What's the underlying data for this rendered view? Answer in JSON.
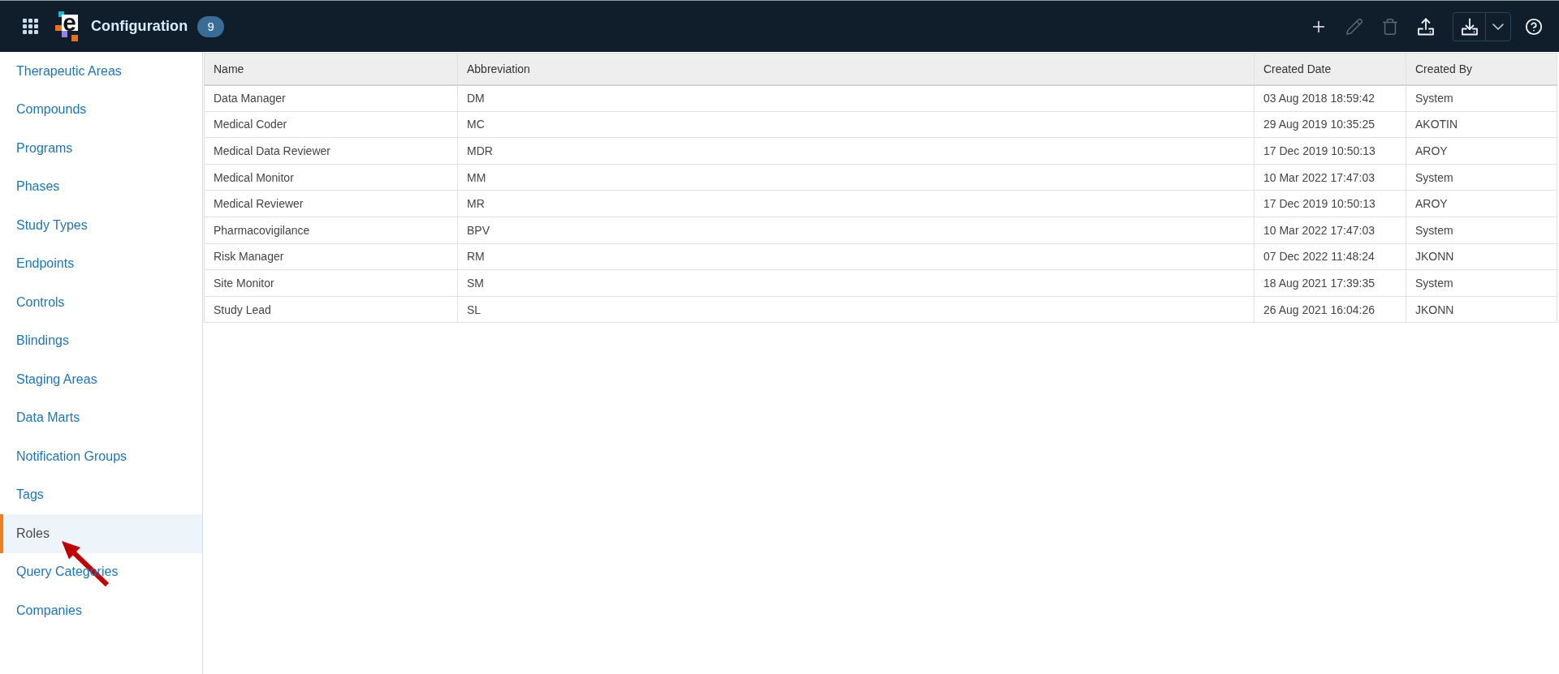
{
  "header": {
    "logo_text": "e",
    "title": "Configuration",
    "count_badge": "9",
    "toolbar": [
      {
        "kind": "add",
        "disabled": false
      },
      {
        "kind": "edit",
        "disabled": true
      },
      {
        "kind": "delete",
        "disabled": true
      },
      {
        "kind": "upload",
        "disabled": false
      },
      {
        "kind": "download",
        "disabled": false
      },
      {
        "kind": "menu",
        "disabled": false
      },
      {
        "kind": "help",
        "disabled": false
      }
    ]
  },
  "sidebar": {
    "items": [
      {
        "label": "Therapeutic Areas",
        "selected": false
      },
      {
        "label": "Compounds",
        "selected": false
      },
      {
        "label": "Programs",
        "selected": false
      },
      {
        "label": "Phases",
        "selected": false
      },
      {
        "label": "Study Types",
        "selected": false
      },
      {
        "label": "Endpoints",
        "selected": false
      },
      {
        "label": "Controls",
        "selected": false
      },
      {
        "label": "Blindings",
        "selected": false
      },
      {
        "label": "Staging Areas",
        "selected": false
      },
      {
        "label": "Data Marts",
        "selected": false
      },
      {
        "label": "Notification Groups",
        "selected": false
      },
      {
        "label": "Tags",
        "selected": false
      },
      {
        "label": "Roles",
        "selected": true
      },
      {
        "label": "Query Categories",
        "selected": false
      },
      {
        "label": "Companies",
        "selected": false
      }
    ]
  },
  "table": {
    "columns": [
      "Name",
      "Abbreviation",
      "Created Date",
      "Created By"
    ],
    "rows": [
      [
        "Data Manager",
        "DM",
        "03 Aug 2018 18:59:42",
        "System"
      ],
      [
        "Medical Coder",
        "MC",
        "29 Aug 2019 10:35:25",
        "AKOTIN"
      ],
      [
        "Medical Data Reviewer",
        "MDR",
        "17 Dec 2019 10:50:13",
        "AROY"
      ],
      [
        "Medical Monitor",
        "MM",
        "10 Mar 2022 17:47:03",
        "System"
      ],
      [
        "Medical Reviewer",
        "MR",
        "17 Dec 2019 10:50:13",
        "AROY"
      ],
      [
        "Pharmacovigilance",
        "BPV",
        "10 Mar 2022 17:47:03",
        "System"
      ],
      [
        "Risk Manager",
        "RM",
        "07 Dec 2022 11:48:24",
        "JKONN"
      ],
      [
        "Site Monitor",
        "SM",
        "18 Aug 2021 17:39:35",
        "System"
      ],
      [
        "Study Lead",
        "SL",
        "26 Aug 2021 16:04:26",
        "JKONN"
      ]
    ]
  }
}
